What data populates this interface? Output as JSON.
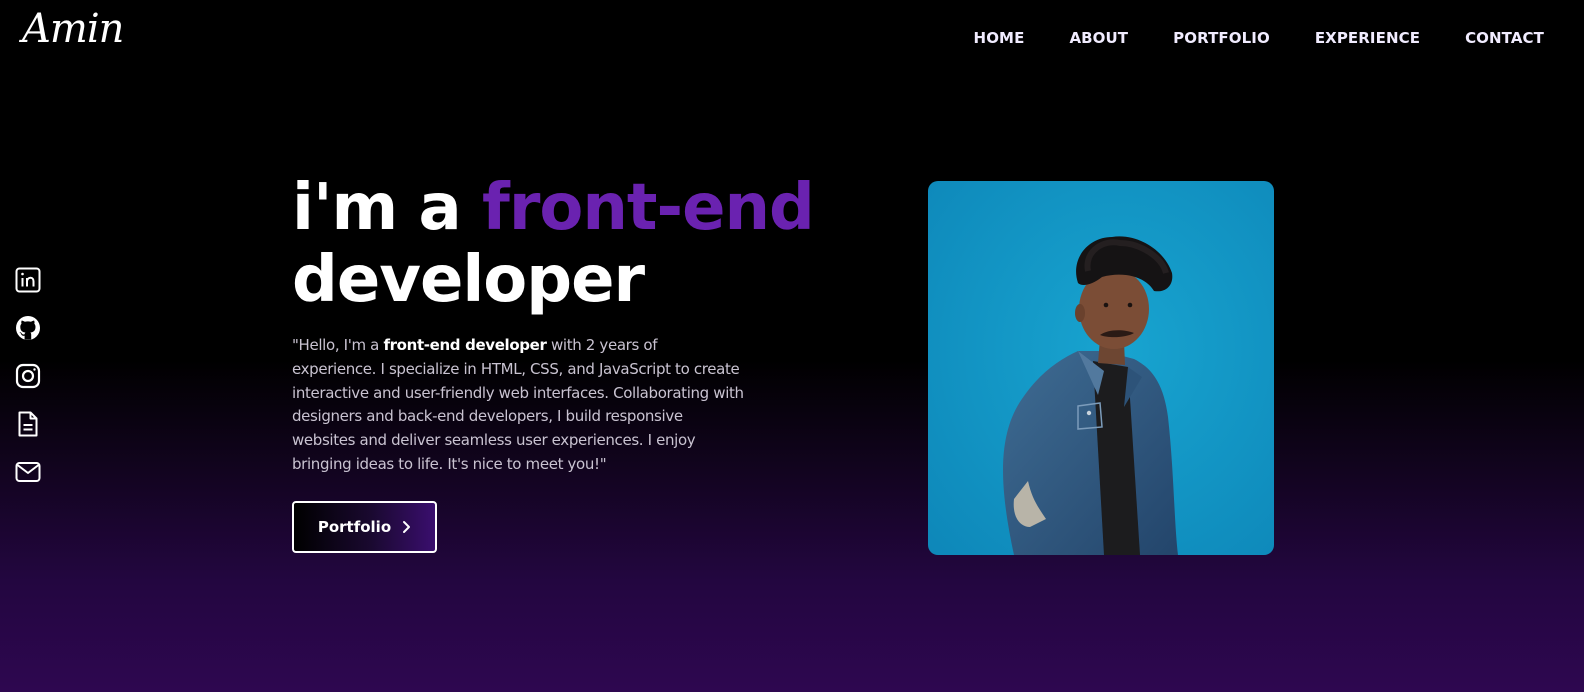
{
  "brand": {
    "logo": "Amin"
  },
  "nav": {
    "items": [
      "HOME",
      "ABOUT",
      "PORTFOLIO",
      "EXPERIENCE",
      "CONTACT"
    ]
  },
  "socials": [
    {
      "icon": "linkedin-icon"
    },
    {
      "icon": "github-icon"
    },
    {
      "icon": "instagram-icon"
    },
    {
      "icon": "resume-icon"
    },
    {
      "icon": "mail-icon"
    }
  ],
  "hero": {
    "title_prefix": "i'm a ",
    "title_accent": "front-end",
    "title_suffix": "developer",
    "desc_start": "\"Hello, I'm a ",
    "desc_bold": "front-end developer",
    "desc_end": " with 2 years of experience. I specialize in HTML, CSS, and JavaScript to create interactive and user-friendly web interfaces. Collaborating with designers and back-end developers, I build responsive websites and deliver seamless user experiences. I enjoy bringing ideas to life. It's nice to meet you!\"",
    "cta_label": "Portfolio"
  },
  "colors": {
    "accent": "#6a22b0",
    "background_bottom": "#2e0750",
    "portrait_background": "#1296c4"
  }
}
